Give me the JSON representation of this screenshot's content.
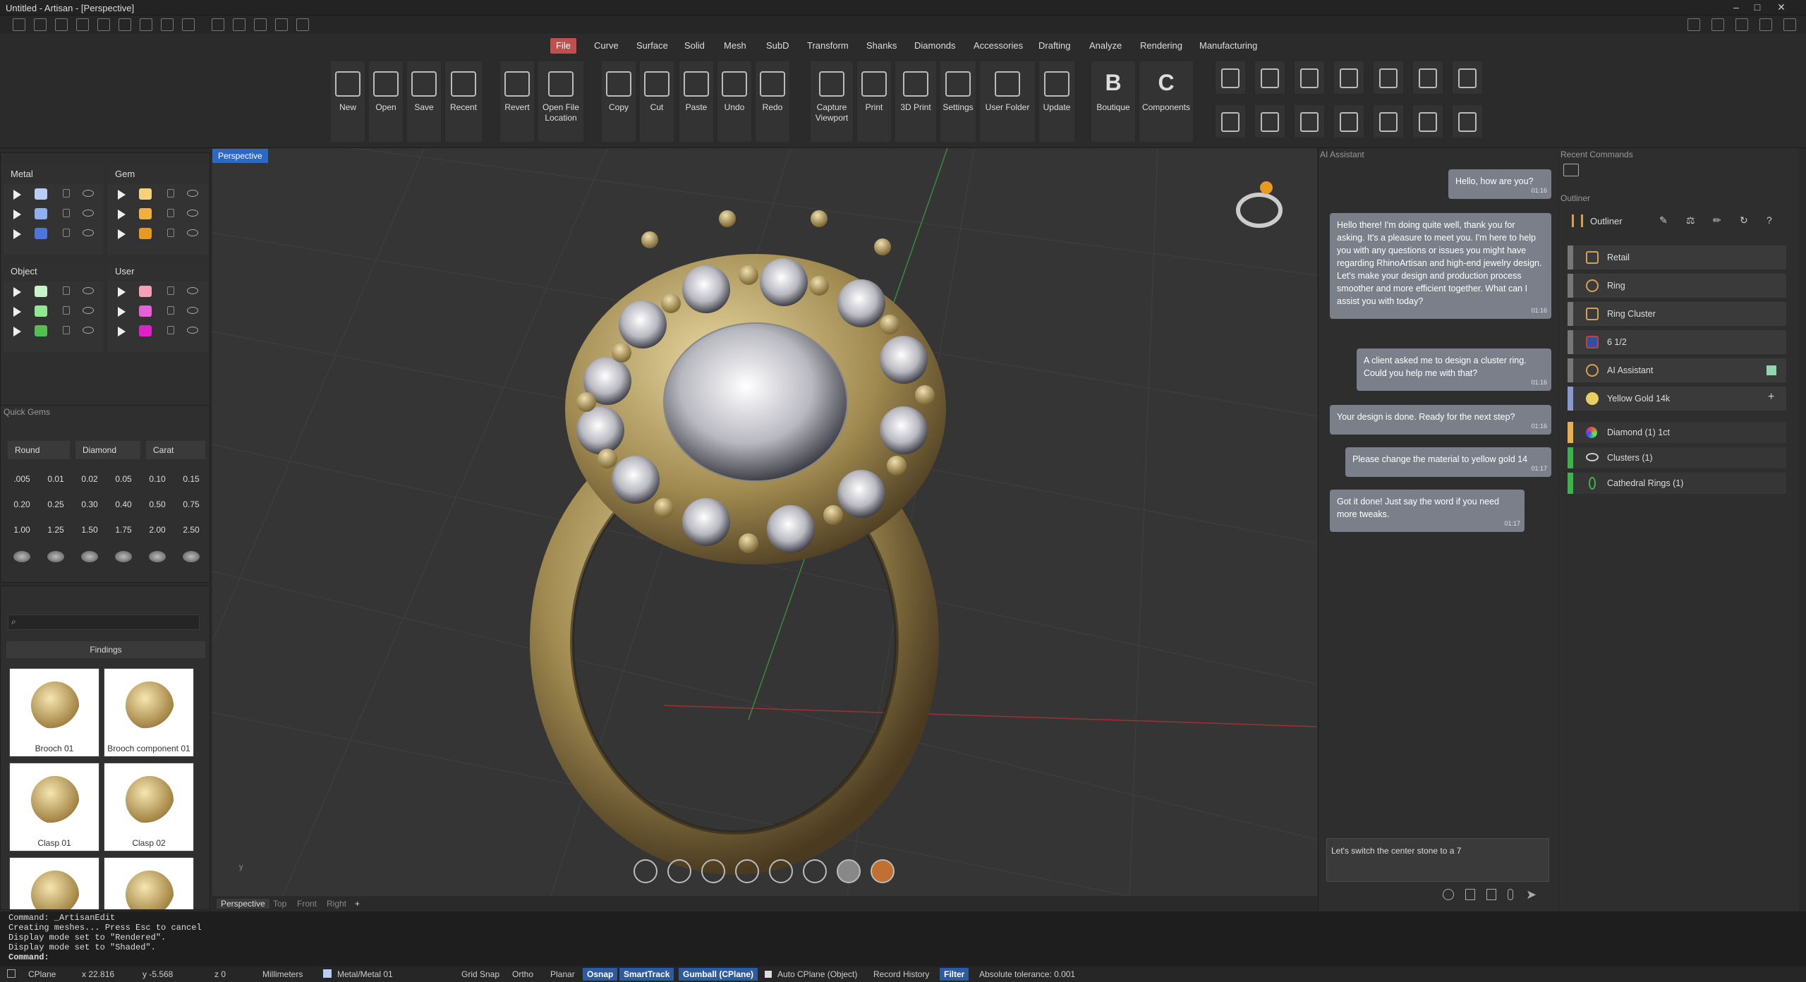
{
  "window": {
    "title": "Untitled - Artisan - [Perspective]"
  },
  "tabs": [
    "File",
    "Curve",
    "Surface",
    "Solid",
    "Mesh",
    "SubD",
    "Transform",
    "Shanks",
    "Diamonds",
    "Accessories",
    "Drafting",
    "Analyze",
    "Rendering",
    "Manufacturing"
  ],
  "ribbon": {
    "buttons": [
      {
        "label": "New",
        "icon": "doc-icon"
      },
      {
        "label": "Open",
        "icon": "folder-icon"
      },
      {
        "label": "Save",
        "icon": "floppy-icon"
      },
      {
        "label": "Recent",
        "icon": "recent-icon"
      },
      {
        "label": "Revert",
        "icon": "revert-icon"
      },
      {
        "label": "Open File\nLocation",
        "icon": "folder-open-icon"
      },
      {
        "label": "Copy",
        "icon": "copy-icon"
      },
      {
        "label": "Cut",
        "icon": "scissors-icon"
      },
      {
        "label": "Paste",
        "icon": "paste-icon"
      },
      {
        "label": "Undo",
        "icon": "undo-icon"
      },
      {
        "label": "Redo",
        "icon": "redo-icon"
      },
      {
        "label": "Capture\nViewport",
        "icon": "camera-icon"
      },
      {
        "label": "Print",
        "icon": "printer-icon"
      },
      {
        "label": "3D Print",
        "icon": "3d-printer-icon"
      },
      {
        "label": "Settings",
        "icon": "settings-icon"
      },
      {
        "label": "User Folder",
        "icon": "user-folder-icon"
      },
      {
        "label": "Update",
        "icon": "refresh-icon"
      },
      {
        "label": "Boutique",
        "icon": "boutique-icon",
        "glyph": "B"
      },
      {
        "label": "Components",
        "icon": "components-icon",
        "glyph": "C"
      }
    ]
  },
  "layers": {
    "metal": {
      "title": "Metal",
      "colors": [
        "#b8cdf5",
        "#8fb0f0",
        "#4a78d8"
      ]
    },
    "gem": {
      "title": "Gem",
      "colors": [
        "#f5d27a",
        "#f0b040",
        "#e89a20"
      ]
    },
    "object": {
      "title": "Object",
      "colors": [
        "#c8f5c8",
        "#90e890",
        "#50c050"
      ]
    },
    "user": {
      "title": "User",
      "colors": [
        "#f5a0b8",
        "#e860d8",
        "#e020c8"
      ]
    }
  },
  "quick_gems": {
    "title": "Quick Gems",
    "shape": "Round",
    "cut": "Diamond",
    "unit": "Carat",
    "values": [
      ".005",
      "0.01",
      "0.02",
      "0.05",
      "0.10",
      "0.15",
      "0.20",
      "0.25",
      "0.30",
      "0.40",
      "0.50",
      "0.75",
      "1.00",
      "1.25",
      "1.50",
      "1.75",
      "2.00",
      "2.50"
    ]
  },
  "library": {
    "category": "Findings",
    "items": [
      "Brooch 01",
      "Brooch component 01",
      "Clasp 01",
      "Clasp 02"
    ]
  },
  "viewport": {
    "name": "Perspective",
    "views": [
      "Perspective",
      "Top",
      "Front",
      "Right"
    ]
  },
  "ai_assistant": {
    "title": "AI Assistant",
    "messages": [
      {
        "role": "user",
        "text": "Hello, how are you?",
        "time": "01:16"
      },
      {
        "role": "bot",
        "text": "Hello there! I'm doing quite well, thank you for asking. It's a pleasure to meet you. I'm here to help you with any questions or issues you might have regarding RhinoArtisan and high-end jewelry design. Let's make your design and production process smoother and more efficient together. What can I assist you with today?",
        "time": "01:16"
      },
      {
        "role": "user",
        "text": "A client asked me to design a cluster ring. Could you help me with that?",
        "time": "01:16"
      },
      {
        "role": "bot",
        "text": "Your design is done. Ready for the next step?",
        "time": "01:16"
      },
      {
        "role": "user",
        "text": "Please change the material to yellow gold 14",
        "time": "01:17"
      },
      {
        "role": "bot",
        "text": "Got it done! Just say the word if you need more tweaks.",
        "time": "01:17"
      }
    ],
    "input": "Let's switch the center stone to a 7"
  },
  "recent_commands": {
    "title": "Recent Commands"
  },
  "outliner": {
    "panel_title": "Outliner",
    "header": "Outliner",
    "items": [
      "Retail",
      "Ring",
      "Ring Cluster",
      "6 1/2",
      "AI Assistant",
      "Yellow Gold 14k"
    ],
    "assets": [
      {
        "label": "Diamond (1) 1ct",
        "color": "#e8b050"
      },
      {
        "label": "Clusters (1)",
        "color": "#3cb44b"
      },
      {
        "label": "Cathedral Rings (1)",
        "color": "#3cb44b"
      }
    ]
  },
  "command_history": [
    "Command: _ArtisanEdit",
    "Creating meshes... Press Esc to cancel",
    "Display mode set to \"Rendered\".",
    "Display mode set to \"Shaded\".",
    "Command:"
  ],
  "status": {
    "cplane": "CPlane",
    "x": "x 22.816",
    "y": "y -5.568",
    "z": "z 0",
    "units": "Millimeters",
    "layer": "Metal/Metal 01",
    "toggles": [
      "Grid Snap",
      "Ortho",
      "Planar",
      "Osnap",
      "SmartTrack",
      "Gumball (CPlane)",
      "Auto CPlane (Object)",
      "Record History",
      "Filter"
    ],
    "tolerance": "Absolute tolerance: 0.001"
  }
}
